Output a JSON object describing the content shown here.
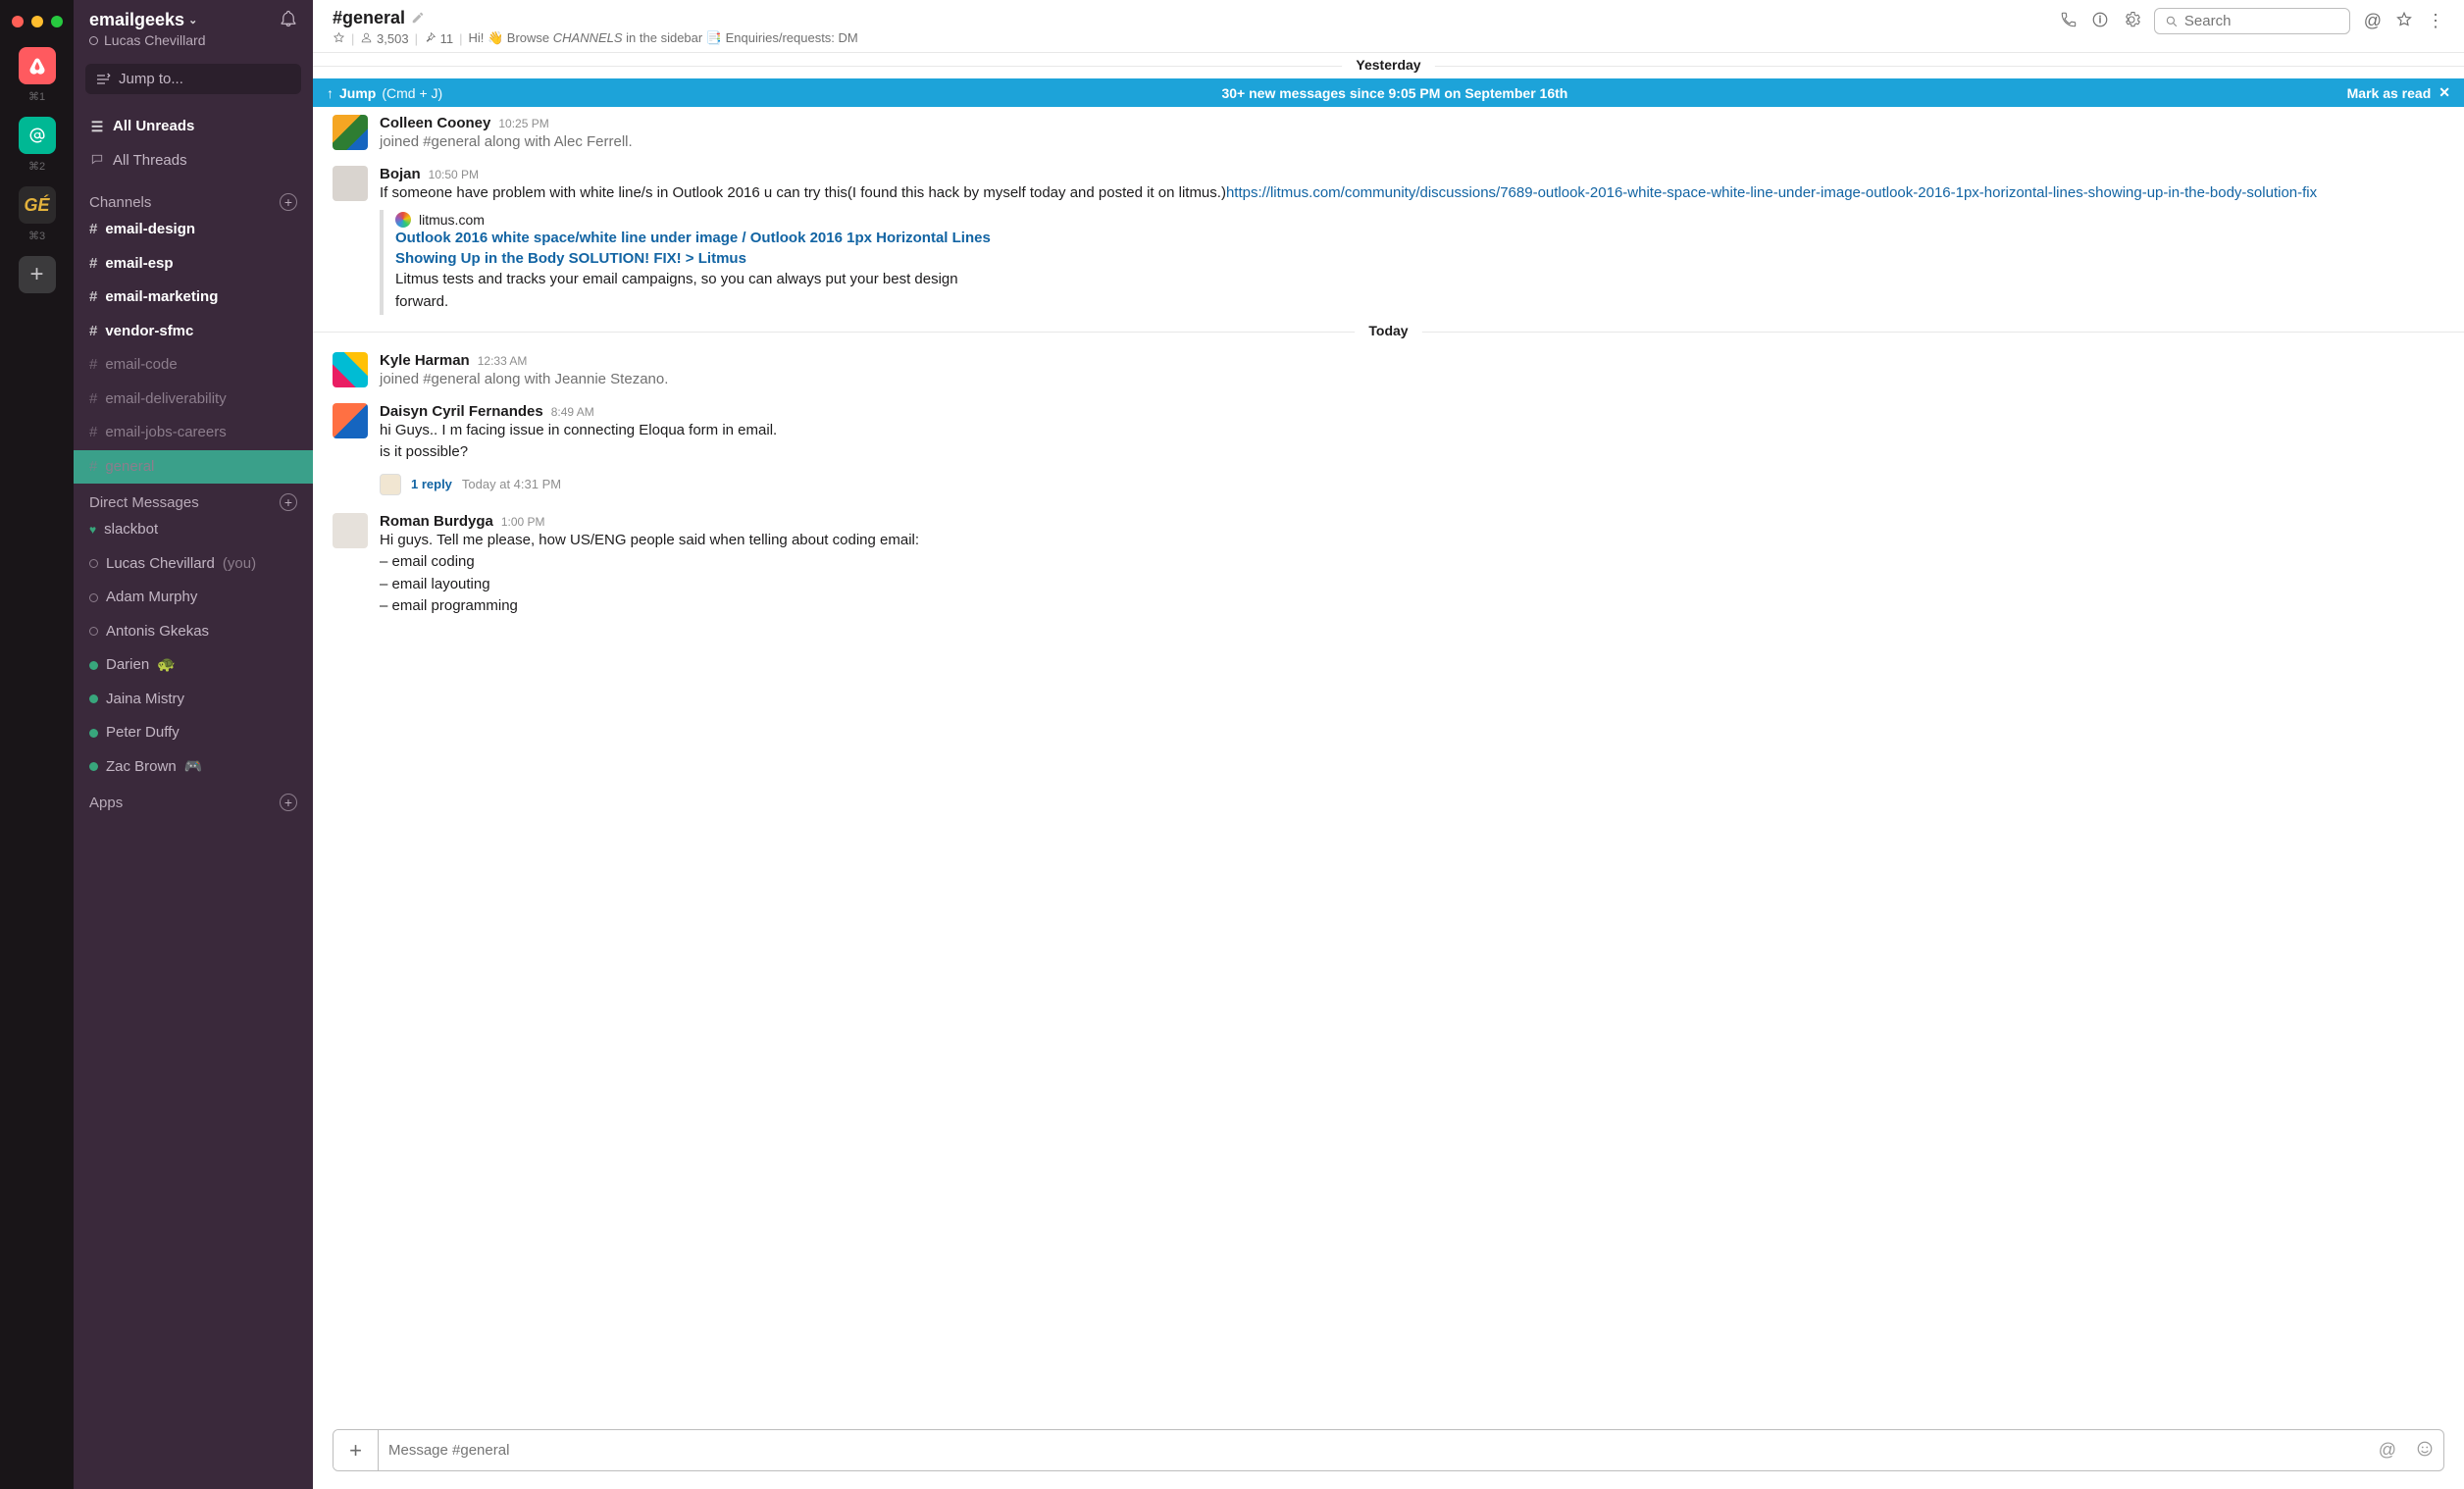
{
  "rail": {
    "shortcuts": [
      "⌘1",
      "⌘2",
      "⌘3"
    ]
  },
  "workspace": {
    "name": "emailgeeks",
    "user": "Lucas Chevillard"
  },
  "jump": {
    "label": "Jump to..."
  },
  "nav": {
    "all_unreads": "All Unreads",
    "all_threads": "All Threads"
  },
  "channels_heading": "Channels",
  "channels": [
    {
      "name": "email-design",
      "unread": true
    },
    {
      "name": "email-esp",
      "unread": true
    },
    {
      "name": "email-marketing",
      "unread": true
    },
    {
      "name": "vendor-sfmc",
      "unread": true
    },
    {
      "name": "email-code",
      "unread": false
    },
    {
      "name": "email-deliverability",
      "unread": false
    },
    {
      "name": "email-jobs-careers",
      "unread": false
    },
    {
      "name": "general",
      "unread": false,
      "selected": true
    }
  ],
  "dm_heading": "Direct Messages",
  "dms": [
    {
      "name": "slackbot",
      "status": "heart"
    },
    {
      "name": "Lucas Chevillard",
      "status": "offline",
      "you_suffix": "(you)"
    },
    {
      "name": "Adam Murphy",
      "status": "offline"
    },
    {
      "name": "Antonis Gkekas",
      "status": "offline"
    },
    {
      "name": "Darien",
      "status": "online",
      "emoji": "🐢"
    },
    {
      "name": "Jaina Mistry",
      "status": "online"
    },
    {
      "name": "Peter Duffy",
      "status": "online"
    },
    {
      "name": "Zac Brown",
      "status": "online",
      "emoji": "🎮"
    }
  ],
  "apps_heading": "Apps",
  "channel": {
    "name": "#general",
    "members": "3,503",
    "pins": "11",
    "topic_prefix": "Hi! ",
    "topic_browse": "Browse ",
    "topic_channels_word": "CHANNELS",
    "topic_in_sidebar": " in the sidebar ",
    "topic_enquiries": " Enquiries/requests: DM "
  },
  "search": {
    "placeholder": "Search"
  },
  "dividers": {
    "yesterday": "Yesterday",
    "today": "Today"
  },
  "banner": {
    "jump_label": "Jump",
    "jump_hint": "(Cmd + J)",
    "summary": "30+ new messages since 9:05 PM on September 16th",
    "mark_read": "Mark as read"
  },
  "messages": [
    {
      "sender": "Colleen Cooney",
      "time": "10:25 PM",
      "system": true,
      "text": "joined #general along with Alec Ferrell."
    },
    {
      "sender": "Bojan",
      "time": "10:50 PM",
      "text_prefix": "If someone have problem with white line/s in Outlook 2016 u can try this(I found this hack by myself today and posted it on litmus.)",
      "link": "https://litmus.com/community/discussions/7689-outlook-2016-white-space-white-line-under-image-outlook-2016-1px-horizontal-lines-showing-up-in-the-body-solution-fix",
      "attachment": {
        "source": "litmus.com",
        "title": "Outlook 2016 white space/white line under image / Outlook 2016 1px Horizontal Lines Showing Up in the Body SOLUTION! FIX! > Litmus",
        "desc": "Litmus tests and tracks your email campaigns, so you can always put your best design forward."
      }
    },
    {
      "sender": "Kyle Harman",
      "time": "12:33 AM",
      "system": true,
      "text": "joined #general along with Jeannie Stezano."
    },
    {
      "sender": "Daisyn Cyril Fernandes",
      "time": "8:49 AM",
      "lines": [
        "hi Guys.. I m facing issue in connecting  Eloqua form in email.",
        "is it possible?"
      ],
      "thread": {
        "replies": "1 reply",
        "reltime": "Today at 4:31 PM"
      }
    },
    {
      "sender": "Roman Burdyga",
      "time": "1:00 PM",
      "lines": [
        "Hi guys. Tell me please, how US/ENG people said when telling about coding email:",
        "–  email coding",
        "–  email layouting",
        "–  email programming"
      ]
    }
  ],
  "composer": {
    "placeholder": "Message #general"
  }
}
